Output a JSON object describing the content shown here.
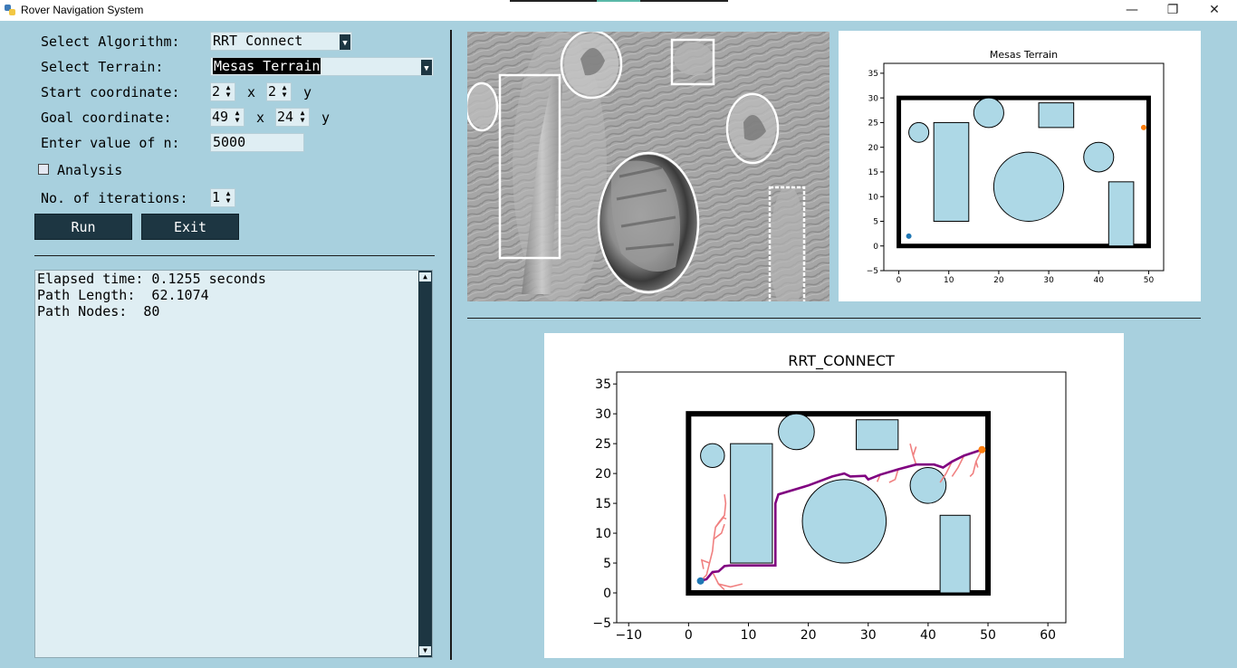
{
  "window": {
    "title": "Rover Navigation System",
    "minimize": "—",
    "restore": "❐",
    "close": "✕"
  },
  "form": {
    "algorithm_label": "Select Algorithm:",
    "algorithm_value": "RRT Connect",
    "terrain_label": "Select Terrain:",
    "terrain_value": "Mesas Terrain",
    "start_label": "Start coordinate:",
    "start_x": "2",
    "start_y": "2",
    "goal_label": "Goal coordinate:",
    "goal_x": "49",
    "goal_y": "24",
    "x_sep": "x",
    "y_suffix": "y",
    "n_label": "Enter value of n:",
    "n_value": "5000",
    "analysis_label": "Analysis",
    "iterations_label": "No. of iterations:",
    "iterations_value": "1",
    "run_label": "Run",
    "exit_label": "Exit"
  },
  "output": {
    "lines": [
      "Elapsed time: 0.1255 seconds",
      "Path Length:  62.1074",
      "Path Nodes:  80"
    ]
  },
  "terrain_plot": {
    "title": "Mesas Terrain",
    "x_ticks": [
      "0",
      "10",
      "20",
      "30",
      "40",
      "50"
    ],
    "y_ticks": [
      "−5",
      "0",
      "5",
      "10",
      "15",
      "20",
      "25",
      "30",
      "35"
    ]
  },
  "path_plot": {
    "title": "RRT_CONNECT",
    "x_ticks": [
      "−10",
      "0",
      "10",
      "20",
      "30",
      "40",
      "50",
      "60"
    ],
    "y_ticks": [
      "−5",
      "0",
      "5",
      "10",
      "15",
      "20",
      "25",
      "30",
      "35"
    ]
  },
  "colors": {
    "background": "#a8d0de",
    "obstacle": "#add8e6",
    "path": "#800080",
    "tree": "#f08080",
    "start": "#1f77b4",
    "goal": "#ff7f0e",
    "button": "#1d3642"
  },
  "chart_data": [
    {
      "type": "scatter",
      "title": "Mesas Terrain",
      "xlim": [
        -3,
        53
      ],
      "ylim": [
        -5,
        37
      ],
      "boundary": [
        0,
        0,
        50,
        30
      ],
      "circles": [
        [
          4,
          23,
          2
        ],
        [
          18,
          27,
          3
        ],
        [
          26,
          12,
          7
        ],
        [
          40,
          18,
          3
        ]
      ],
      "rects": [
        [
          7,
          5,
          7,
          20
        ],
        [
          28,
          24,
          7,
          5
        ],
        [
          42,
          0,
          5,
          13
        ]
      ],
      "start": [
        2,
        2
      ],
      "goal": [
        49,
        24
      ]
    },
    {
      "type": "line",
      "title": "RRT_CONNECT",
      "xlim": [
        -12,
        63
      ],
      "ylim": [
        -5,
        37
      ],
      "boundary": [
        0,
        0,
        50,
        30
      ],
      "circles": [
        [
          4,
          23,
          2
        ],
        [
          18,
          27,
          3
        ],
        [
          26,
          12,
          7
        ],
        [
          40,
          18,
          3
        ]
      ],
      "rects": [
        [
          7,
          5,
          7,
          20
        ],
        [
          28,
          24,
          7,
          5
        ],
        [
          42,
          0,
          5,
          13
        ]
      ],
      "start": [
        2,
        2
      ],
      "goal": [
        49,
        24
      ],
      "path": [
        [
          2,
          2
        ],
        [
          3,
          2.3
        ],
        [
          4,
          3.5
        ],
        [
          5,
          3.6
        ],
        [
          6,
          4.5
        ],
        [
          7,
          4.6
        ],
        [
          10,
          4.6
        ],
        [
          14.5,
          4.6
        ],
        [
          14.5,
          15
        ],
        [
          15,
          16.5
        ],
        [
          20,
          18
        ],
        [
          24,
          19.5
        ],
        [
          26,
          20
        ],
        [
          27,
          19.5
        ],
        [
          29.5,
          19.6
        ],
        [
          30,
          19
        ],
        [
          32,
          19.8
        ],
        [
          35,
          20.7
        ],
        [
          38,
          21.5
        ],
        [
          41,
          21.5
        ],
        [
          42.5,
          21
        ],
        [
          44,
          22
        ],
        [
          46,
          23
        ],
        [
          49,
          24
        ]
      ],
      "tree_branches": [
        [
          [
            2,
            2
          ],
          [
            3,
            3
          ],
          [
            3.5,
            5
          ],
          [
            4,
            7
          ],
          [
            4.2,
            9
          ],
          [
            4.5,
            11
          ],
          [
            5.2,
            12
          ],
          [
            6,
            13
          ],
          [
            6.2,
            15
          ],
          [
            6,
            16.5
          ]
        ],
        [
          [
            4.2,
            9
          ],
          [
            5.5,
            10
          ],
          [
            6,
            11.5
          ]
        ],
        [
          [
            4.5,
            11
          ],
          [
            5.8,
            12.6
          ],
          [
            6.3,
            12.4
          ]
        ],
        [
          [
            3.5,
            5
          ],
          [
            2.2,
            5.5
          ],
          [
            2.5,
            4
          ]
        ],
        [
          [
            4,
            3.5
          ],
          [
            5,
            1.5
          ],
          [
            7,
            1
          ],
          [
            9,
            1.5
          ]
        ],
        [
          [
            5,
            1.5
          ],
          [
            6,
            0.5
          ]
        ],
        [
          [
            49,
            24
          ],
          [
            48,
            22
          ],
          [
            47.5,
            20
          ],
          [
            47,
            19.5
          ]
        ],
        [
          [
            48,
            22
          ],
          [
            48.3,
            21
          ]
        ],
        [
          [
            46,
            23
          ],
          [
            45,
            21
          ],
          [
            44,
            19.5
          ]
        ],
        [
          [
            44,
            22
          ],
          [
            43,
            20
          ],
          [
            42,
            18.5
          ]
        ],
        [
          [
            38,
            21.5
          ],
          [
            37.5,
            23
          ],
          [
            37,
            25
          ]
        ],
        [
          [
            37.5,
            23
          ],
          [
            38,
            24.5
          ]
        ],
        [
          [
            35,
            20.7
          ],
          [
            34.5,
            19
          ],
          [
            33.5,
            18.5
          ]
        ],
        [
          [
            32,
            19.8
          ],
          [
            31.5,
            18.6
          ]
        ]
      ]
    }
  ]
}
